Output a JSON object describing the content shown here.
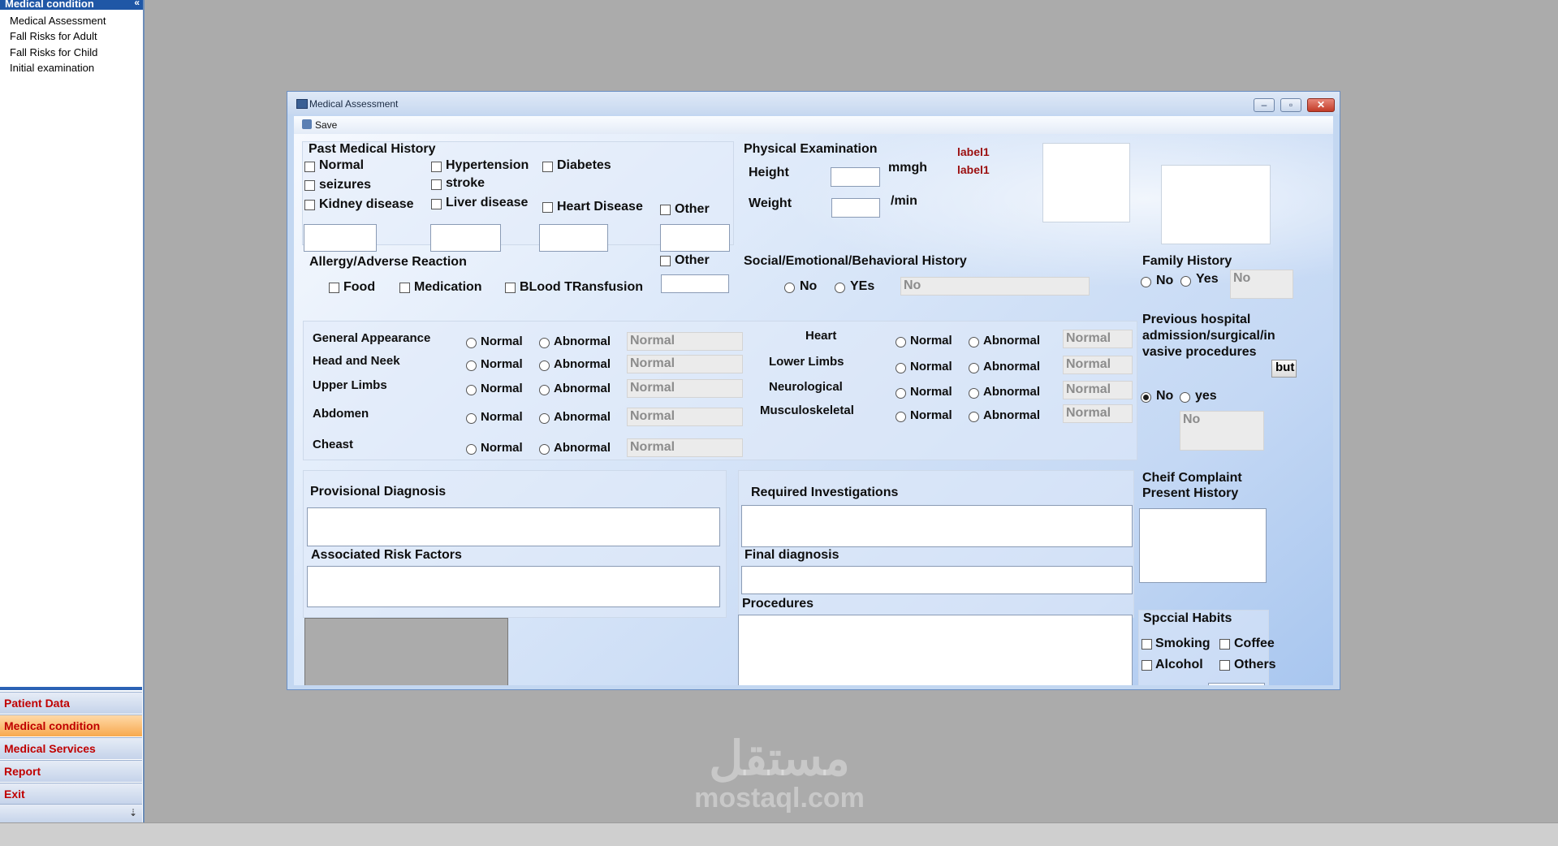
{
  "nav": {
    "header": "Medical condition",
    "collapse_glyph": "«",
    "items": [
      "Medical Assessment",
      "Fall Risks for Adult",
      "Fall Risks for Child",
      "Initial examination"
    ],
    "buttons": [
      "Patient Data",
      "Medical condition",
      "Medical Services",
      "Report",
      "Exit"
    ],
    "active": "Medical condition",
    "more_glyph": "⇣"
  },
  "window": {
    "title": "Medical Assessment",
    "save_label": "Save",
    "min_glyph": "–",
    "max_glyph": "▫",
    "close_glyph": "✕"
  },
  "past_history": {
    "title": "Past Medical History",
    "normal": "Normal",
    "seizures": "seizures",
    "kidney": "Kidney disease",
    "hypertension": "Hypertension",
    "stroke": "stroke",
    "liver": "Liver disease",
    "diabetes": "Diabetes",
    "heart": "Heart Disease",
    "other": "Other"
  },
  "allergy": {
    "title": "Allergy/Adverse Reaction",
    "other": "Other",
    "food": "Food",
    "medication": "Medication",
    "blood": "BLood TRansfusion"
  },
  "physical": {
    "title": "Physical Examination",
    "height": "Height",
    "weight": "Weight",
    "unit_height": "mmgh",
    "unit_weight": "/min",
    "label1a": "label1",
    "label1b": "label1"
  },
  "social": {
    "title": "Social/Emotional/Behavioral History",
    "no": "No",
    "yes": "YEs",
    "value": "No"
  },
  "family": {
    "title": "Family History",
    "no": "No",
    "yes": "Yes",
    "value": "No"
  },
  "previous": {
    "title": "Previous hospital admission/surgical/in vasive procedures",
    "button": "but",
    "no": "No",
    "yes": "yes",
    "selected": "No",
    "value": "No"
  },
  "exam": {
    "normal": "Normal",
    "abnormal": "Abnormal",
    "left": [
      {
        "label": "General Appearance",
        "value": "Normal"
      },
      {
        "label": "Head and Neek",
        "value": "Normal"
      },
      {
        "label": "Upper Limbs",
        "value": "Normal"
      },
      {
        "label": "Abdomen",
        "value": "Normal"
      },
      {
        "label": "Cheast",
        "value": "Normal"
      }
    ],
    "right": [
      {
        "label": "Heart",
        "value": "Normal"
      },
      {
        "label": "Lower Limbs",
        "value": "Normal"
      },
      {
        "label": "Neurological",
        "value": "Normal"
      },
      {
        "label": "Musculoskeletal",
        "value": "Normal"
      }
    ]
  },
  "diagnosis": {
    "provisional": "Provisional Diagnosis",
    "risk": "Associated Risk Factors",
    "required": "Required Investigations",
    "final": "Final diagnosis",
    "procedures": "Procedures",
    "complaint": "Cheif Complaint Present History"
  },
  "habits": {
    "title": "Spccial Habits",
    "smoking": "Smoking",
    "coffee": "Coffee",
    "alcohol": "Alcohol",
    "others": "Others"
  },
  "watermark": {
    "arabic": "مستقل",
    "site": "mostaql.com"
  }
}
